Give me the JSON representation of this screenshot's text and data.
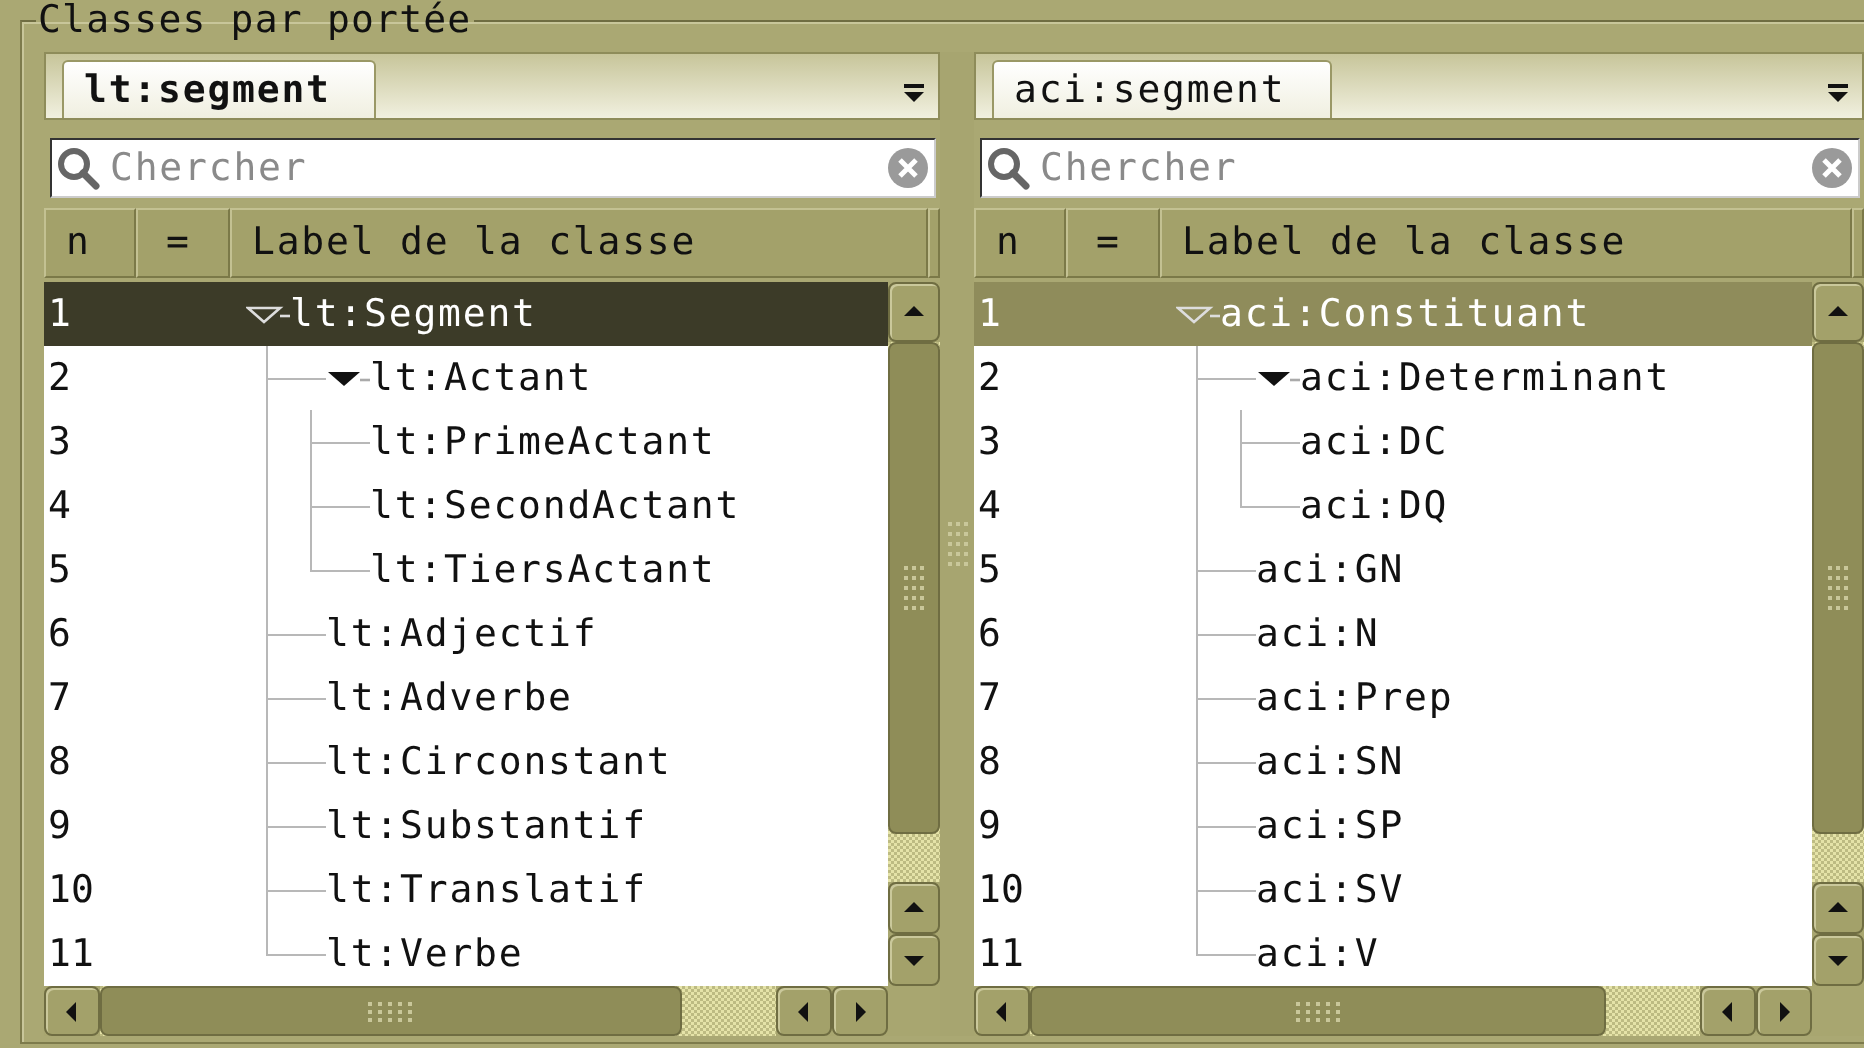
{
  "group": {
    "title": "Classes par portée"
  },
  "panels": [
    {
      "focused": true,
      "tab": {
        "label": "lt:segment",
        "selected": true
      },
      "search": {
        "placeholder": "Chercher"
      },
      "columns": [
        "n",
        "=",
        "Label de la classe"
      ],
      "rows": [
        {
          "n": "1",
          "label": "lt:Segment",
          "expanded": true,
          "selected": true,
          "children": [
            {
              "n": "2",
              "label": "lt:Actant",
              "expanded": true,
              "selected": false,
              "children": [
                {
                  "n": "3",
                  "label": "lt:PrimeActant",
                  "selected": false
                },
                {
                  "n": "4",
                  "label": "lt:SecondActant",
                  "selected": false
                },
                {
                  "n": "5",
                  "label": "lt:TiersActant",
                  "selected": false
                }
              ]
            },
            {
              "n": "6",
              "label": "lt:Adjectif",
              "selected": false
            },
            {
              "n": "7",
              "label": "lt:Adverbe",
              "selected": false
            },
            {
              "n": "8",
              "label": "lt:Circonstant",
              "selected": false
            },
            {
              "n": "9",
              "label": "lt:Substantif",
              "selected": false
            },
            {
              "n": "10",
              "label": "lt:Translatif",
              "selected": false
            },
            {
              "n": "11",
              "label": "lt:Verbe",
              "selected": false
            }
          ]
        }
      ]
    },
    {
      "focused": false,
      "tab": {
        "label": "aci:segment",
        "selected": true
      },
      "search": {
        "placeholder": "Chercher"
      },
      "columns": [
        "n",
        "=",
        "Label de la classe"
      ],
      "rows": [
        {
          "n": "1",
          "label": "aci:Constituant",
          "expanded": true,
          "selected": true,
          "children": [
            {
              "n": "2",
              "label": "aci:Determinant",
              "expanded": true,
              "selected": false,
              "children": [
                {
                  "n": "3",
                  "label": "aci:DC",
                  "selected": false
                },
                {
                  "n": "4",
                  "label": "aci:DQ",
                  "selected": false
                }
              ]
            },
            {
              "n": "5",
              "label": "aci:GN",
              "selected": false
            },
            {
              "n": "6",
              "label": "aci:N",
              "selected": false
            },
            {
              "n": "7",
              "label": "aci:Prep",
              "selected": false
            },
            {
              "n": "8",
              "label": "aci:SN",
              "selected": false
            },
            {
              "n": "9",
              "label": "aci:SP",
              "selected": false
            },
            {
              "n": "10",
              "label": "aci:SV",
              "selected": false
            },
            {
              "n": "11",
              "label": "aci:V",
              "selected": false
            }
          ]
        }
      ]
    }
  ]
}
